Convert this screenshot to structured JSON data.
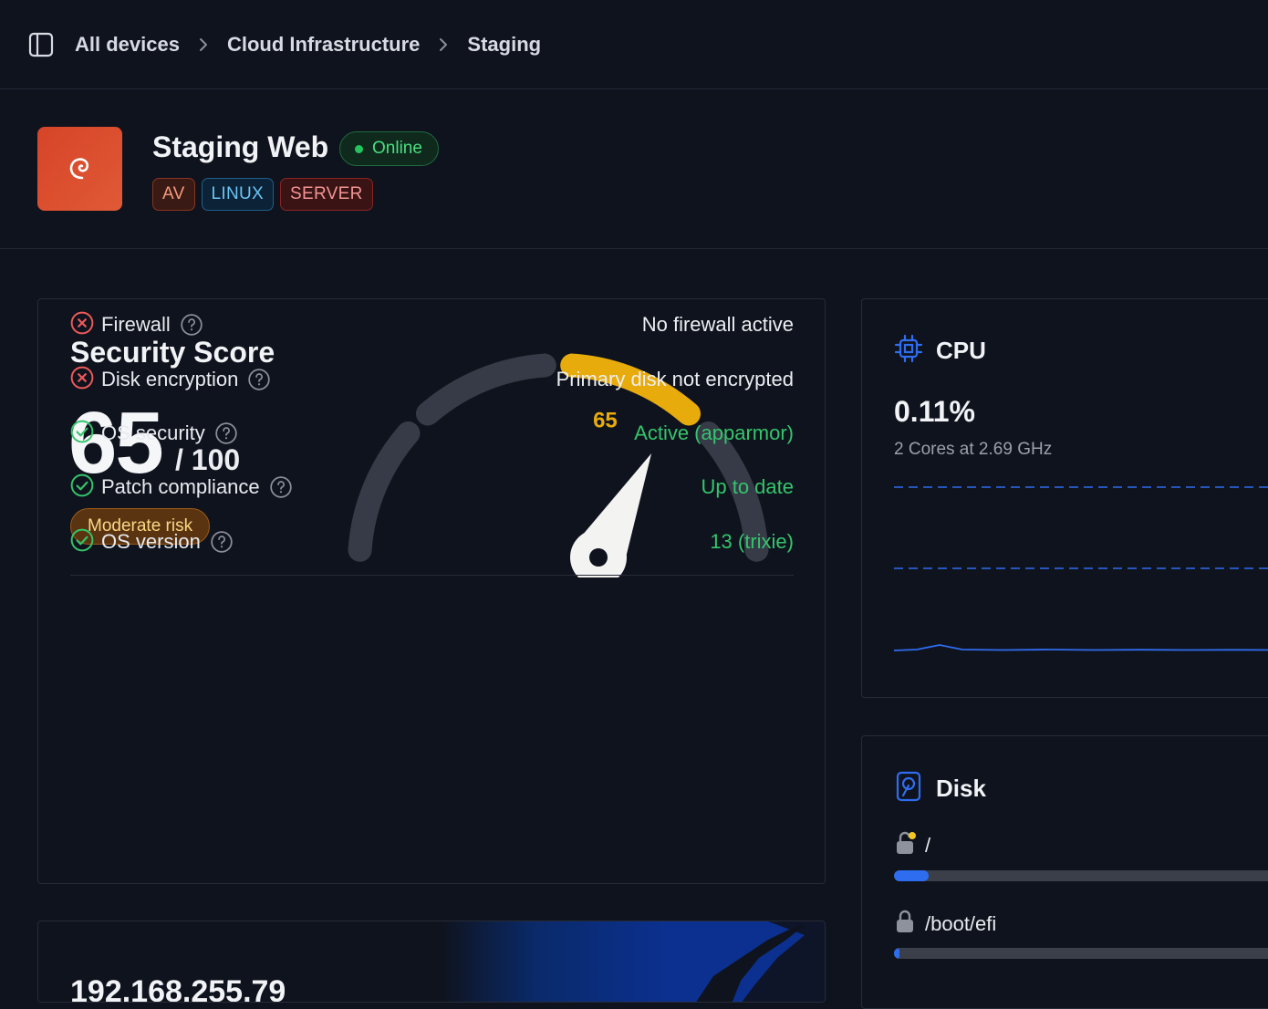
{
  "breadcrumb": {
    "items": [
      "All devices",
      "Cloud Infrastructure",
      "Staging"
    ]
  },
  "device": {
    "name": "Staging Web",
    "status": "Online",
    "tags": [
      "AV",
      "LINUX",
      "SERVER"
    ],
    "logo_icon": "debian-swirl-icon"
  },
  "security": {
    "title": "Security Score",
    "score": "65",
    "max": "/ 100",
    "gauge_value": 65,
    "gauge_label": "65",
    "risk": "Moderate risk",
    "checks": [
      {
        "label": "Firewall",
        "value": "No firewall active",
        "status": "fail"
      },
      {
        "label": "Disk encryption",
        "value": "Primary disk not encrypted",
        "status": "fail"
      },
      {
        "label": "OS security",
        "value": "Active (apparmor)",
        "status": "pass"
      },
      {
        "label": "Patch compliance",
        "value": "Up to date",
        "status": "pass"
      },
      {
        "label": "OS version",
        "value": "13 (trixie)",
        "status": "pass"
      }
    ]
  },
  "ip": {
    "address": "192.168.255.79"
  },
  "cpu": {
    "title": "CPU",
    "value": "0.11%",
    "subtitle": "2 Cores at 2.69 GHz"
  },
  "disk": {
    "title": "Disk",
    "mounts": [
      {
        "label": "/",
        "used_fraction": 0.09
      },
      {
        "label": "/boot/efi",
        "used_fraction": 0.015
      }
    ]
  },
  "colors": {
    "accent_blue": "#2f6df0",
    "gauge_yellow": "#e8ab0c",
    "pass_green": "#34c56c",
    "fail_red": "#ef5a5a"
  }
}
